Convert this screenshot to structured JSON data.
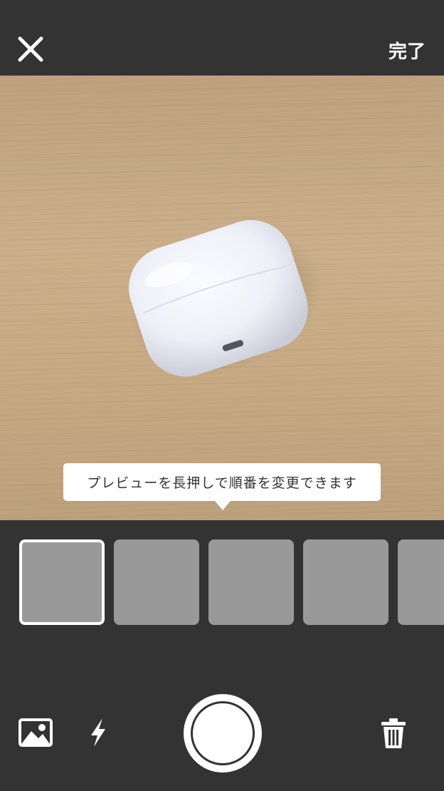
{
  "header": {
    "close_icon": "close-icon",
    "done_label": "完了"
  },
  "tooltip": {
    "text": "プレビューを長押しで順番を変更できます"
  },
  "thumbnails": {
    "count_visible": 5,
    "selected_index": 0
  },
  "toolbar": {
    "gallery_icon": "image-icon",
    "flash_icon": "flash-icon",
    "shutter": "shutter-button",
    "trash_icon": "trash-icon"
  },
  "colors": {
    "background": "#333333",
    "thumbnail": "#999999",
    "foreground": "#ffffff"
  }
}
